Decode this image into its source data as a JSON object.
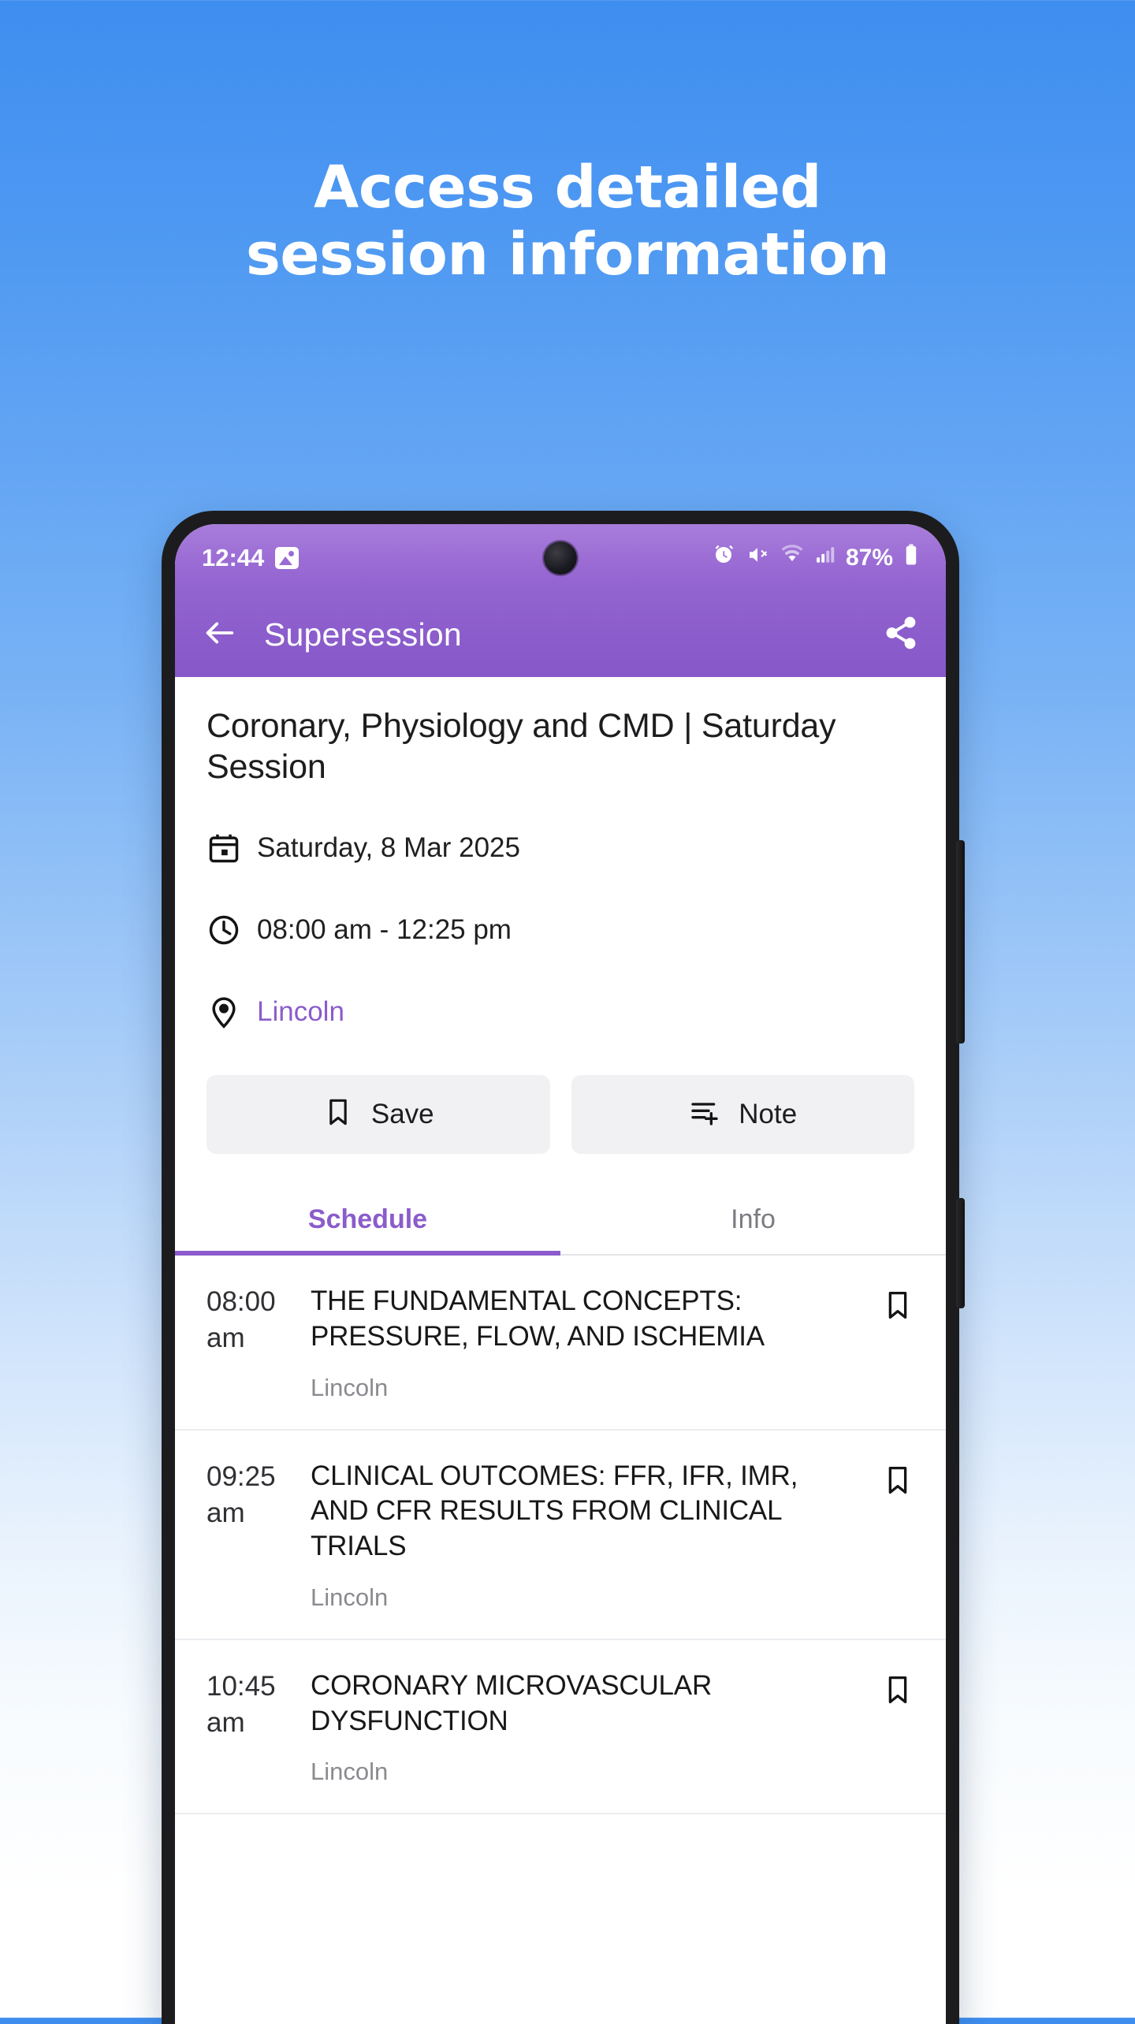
{
  "hero": {
    "line1": "Access detailed",
    "line2": "session information"
  },
  "status_bar": {
    "time": "12:44",
    "image_icon": "picture-icon",
    "alarm_icon": "alarm-icon",
    "mute_icon": "volume-mute-icon",
    "wifi_icon": "wifi-icon",
    "signal_icon": "cellular-signal-icon",
    "battery_percent": "87%",
    "battery_icon": "battery-icon"
  },
  "app_bar": {
    "back_icon": "back-arrow-icon",
    "title": "Supersession",
    "share_icon": "share-icon"
  },
  "session": {
    "title": "Coronary, Physiology and CMD | Saturday Session",
    "date": "Saturday, 8 Mar 2025",
    "time": "08:00 am - 12:25 pm",
    "location": "Lincoln",
    "date_icon": "calendar-icon",
    "time_icon": "clock-icon",
    "location_icon": "map-pin-icon"
  },
  "actions": {
    "save_label": "Save",
    "save_icon": "bookmark-icon",
    "note_label": "Note",
    "note_icon": "note-add-icon"
  },
  "tabs": [
    {
      "label": "Schedule",
      "active": true
    },
    {
      "label": "Info",
      "active": false
    }
  ],
  "schedule": [
    {
      "time": "08:00 am",
      "title": "THE FUNDAMENTAL CONCEPTS: PRESSURE, FLOW, AND ISCHEMIA",
      "room": "Lincoln",
      "bookmark_icon": "bookmark-icon"
    },
    {
      "time": "09:25 am",
      "title": "CLINICAL OUTCOMES: FFR, IFR, IMR, AND CFR RESULTS FROM CLINICAL TRIALS",
      "room": "Lincoln",
      "bookmark_icon": "bookmark-icon"
    },
    {
      "time": "10:45 am",
      "title": "CORONARY MICROVASCULAR DYSFUNCTION",
      "room": "Lincoln",
      "bookmark_icon": "bookmark-icon"
    }
  ],
  "colors": {
    "background_top": "#3e8ef0",
    "background_bottom": "#ffffff",
    "app_bar_purple": "#8b5ccb",
    "status_bar_purple": "#9a6bd4",
    "accent_purple": "#8b5ccb",
    "button_grey": "#f1f1f3",
    "muted_text": "#8a8a90"
  }
}
